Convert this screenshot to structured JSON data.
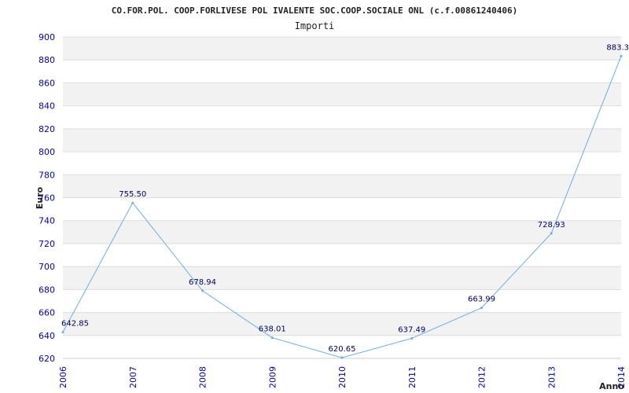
{
  "chart_data": {
    "type": "line",
    "title": "CO.FOR.POL. COOP.FORLIVESE POL IVALENTE SOC.COOP.SOCIALE ONL (c.f.00861240406)",
    "subtitle": "Importi",
    "xlabel": "Anno",
    "ylabel": "Euro",
    "ylim": [
      620,
      900
    ],
    "yticks": [
      "900",
      "880",
      "860",
      "840",
      "820",
      "800",
      "780",
      "760",
      "740",
      "720",
      "700",
      "680",
      "660",
      "640",
      "620"
    ],
    "categories": [
      "2006",
      "2007",
      "2008",
      "2009",
      "2010",
      "2011",
      "2012",
      "2013",
      "2014"
    ],
    "values": [
      642.85,
      755.5,
      678.94,
      638.01,
      620.65,
      637.49,
      663.99,
      728.93,
      883.3
    ],
    "data_labels": [
      "642.85",
      "755.50",
      "678.94",
      "638.01",
      "620.65",
      "637.49",
      "663.99",
      "728.93",
      "883.3"
    ],
    "grid": true,
    "colors": {
      "line": "#6aaee6",
      "band": "#f2f2f2",
      "tick_text": "#0000cc",
      "label_text": "#000066"
    }
  }
}
